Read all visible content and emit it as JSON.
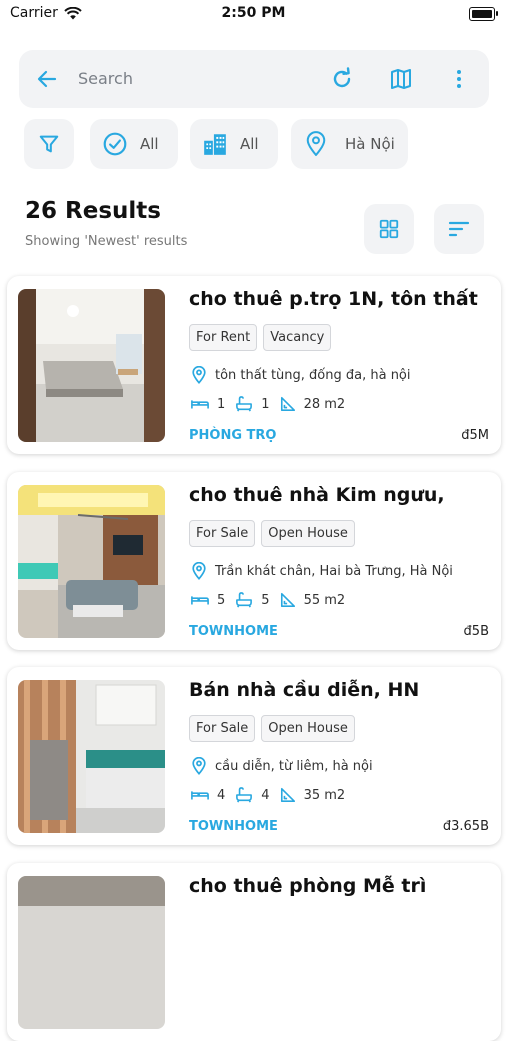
{
  "status": {
    "carrier": "Carrier",
    "time": "2:50 PM"
  },
  "search": {
    "placeholder": "Search"
  },
  "filters": {
    "status": "All",
    "type": "All",
    "location": "Hà Nội"
  },
  "results": {
    "title": "26 Results",
    "subtitle": "Showing 'Newest' results"
  },
  "colors": {
    "accent": "#29a8e0",
    "chip_bg": "#f2f3f5"
  },
  "listings": [
    {
      "title": "cho thuê p.trọ 1N, tôn thất",
      "tags": [
        "For Rent",
        "Vacancy"
      ],
      "address": "tôn thất tùng, đống đa, hà nội",
      "beds": "1",
      "baths": "1",
      "area": "28 m2",
      "type": "PHÒNG TRỌ",
      "price": "đ5M"
    },
    {
      "title": "cho thuê nhà Kim ngưu,",
      "tags": [
        "For Sale",
        "Open House"
      ],
      "address": "Trần khát chân, Hai bà Trưng, Hà Nội",
      "beds": "5",
      "baths": "5",
      "area": "55 m2",
      "type": "TOWNHOME",
      "price": "đ5B"
    },
    {
      "title": "Bán nhà cầu diễn, HN",
      "tags": [
        "For Sale",
        "Open House"
      ],
      "address": "cầu diễn, từ liêm, hà nội",
      "beds": "4",
      "baths": "4",
      "area": "35 m2",
      "type": "TOWNHOME",
      "price": "đ3.65B"
    },
    {
      "title": "cho thuê phòng Mễ trì"
    }
  ]
}
